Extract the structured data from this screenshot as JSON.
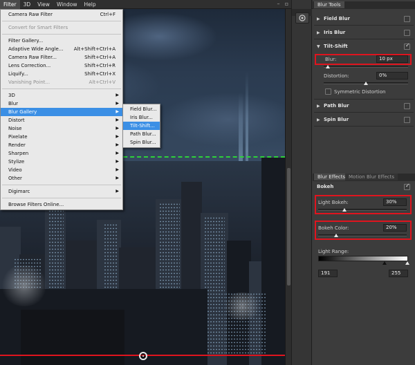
{
  "menubar": {
    "items": [
      "Filter",
      "3D",
      "View",
      "Window",
      "Help"
    ]
  },
  "filter_menu": {
    "items": [
      {
        "label": "Camera Raw Filter",
        "shortcut": "Ctrl+F"
      },
      {
        "label": "Convert for Smart Filters",
        "shortcut": ""
      },
      {
        "label": "Filter Gallery...",
        "shortcut": ""
      },
      {
        "label": "Adaptive Wide Angle...",
        "shortcut": "Alt+Shift+Ctrl+A"
      },
      {
        "label": "Camera Raw Filter...",
        "shortcut": "Shift+Ctrl+A"
      },
      {
        "label": "Lens Correction...",
        "shortcut": "Shift+Ctrl+R"
      },
      {
        "label": "Liquify...",
        "shortcut": "Shift+Ctrl+X"
      },
      {
        "label": "Vanishing Point...",
        "shortcut": "Alt+Ctrl+V"
      },
      {
        "label": "3D"
      },
      {
        "label": "Blur"
      },
      {
        "label": "Blur Gallery"
      },
      {
        "label": "Distort"
      },
      {
        "label": "Noise"
      },
      {
        "label": "Pixelate"
      },
      {
        "label": "Render"
      },
      {
        "label": "Sharpen"
      },
      {
        "label": "Stylize"
      },
      {
        "label": "Video"
      },
      {
        "label": "Other"
      },
      {
        "label": "Digimarc"
      },
      {
        "label": "Browse Filters Online..."
      }
    ]
  },
  "blur_gallery_submenu": {
    "items": [
      "Field Blur...",
      "Iris Blur...",
      "Tilt-Shift...",
      "Path Blur...",
      "Spin Blur..."
    ]
  },
  "blur_tools": {
    "tab": "Blur Tools",
    "sections": [
      "Field Blur",
      "Iris Blur",
      "Tilt-Shift",
      "Path Blur",
      "Spin Blur"
    ],
    "tilt_shift": {
      "blur_label": "Blur:",
      "blur_value": "10 px",
      "blur_level": 0.05,
      "distortion_label": "Distortion:",
      "distortion_value": "0%",
      "distortion_level": 0.5,
      "symmetric_label": "Symmetric Distortion"
    }
  },
  "blur_effects": {
    "tab": "Blur Effects",
    "tab2": "Motion Blur Effects",
    "bokeh_label": "Bokeh",
    "light_bokeh_label": "Light Bokeh:",
    "light_bokeh_value": "30%",
    "light_bokeh_level": 0.3,
    "bokeh_color_label": "Bokeh Color:",
    "bokeh_color_value": "20%",
    "bokeh_color_level": 0.2,
    "light_range_label": "Light Range:",
    "light_range_low": "191",
    "light_range_high": "255"
  },
  "colors": {
    "highlight": "#3b8fe5",
    "annotation": "#e0141e",
    "guide": "#2ed13a"
  }
}
